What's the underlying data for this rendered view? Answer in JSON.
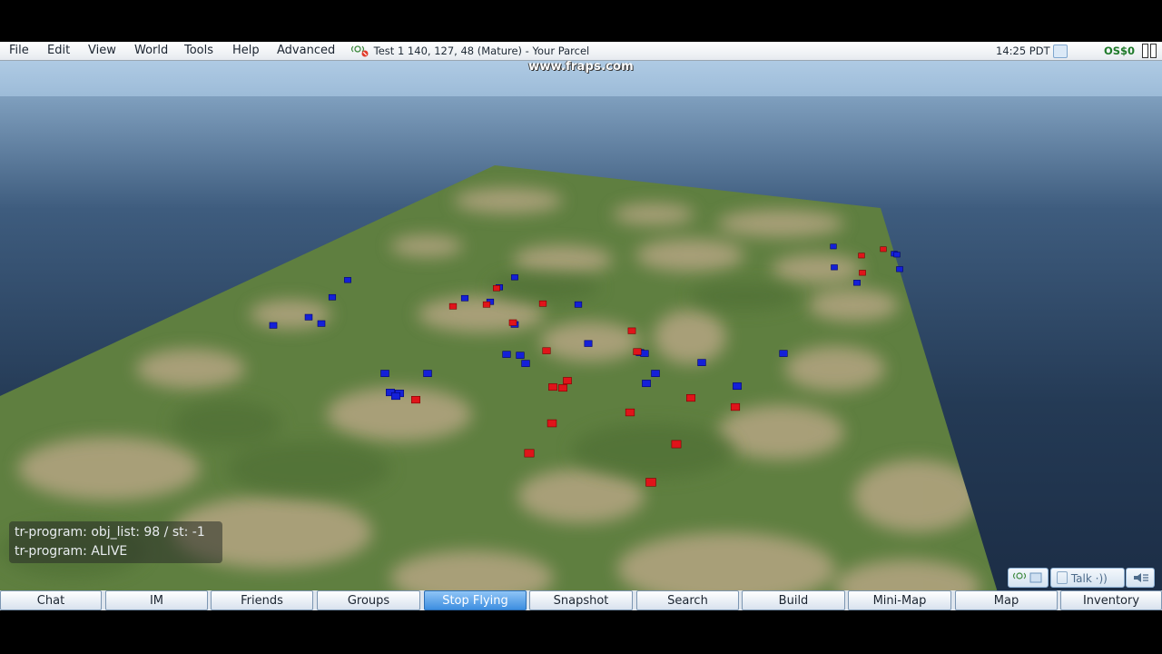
{
  "menu": {
    "items": [
      "File",
      "Edit",
      "View",
      "World",
      "Tools",
      "Help",
      "Advanced"
    ]
  },
  "status": {
    "location": "Test 1 140, 127, 48 (Mature) - Your Parcel",
    "time": "14:25 PDT",
    "balance": "OS$0"
  },
  "watermark": "www.fraps.com",
  "debug": {
    "line1": "tr-program: obj_list: 98 / st: -1",
    "line2": "tr-program: ALIVE"
  },
  "voice": {
    "talk_label": "Talk"
  },
  "toolbar": {
    "buttons": [
      "Chat",
      "IM",
      "Friends",
      "Groups",
      "Stop Flying",
      "Snapshot",
      "Search",
      "Build",
      "Mini-Map",
      "Map",
      "Inventory"
    ],
    "active": "Stop Flying"
  },
  "colors": {
    "red_object": "#e0141a",
    "blue_object": "#1420d8",
    "terrain_green": "#5d7d3e",
    "terrain_sand": "#b3a27e",
    "water": "#22354e",
    "sky": "#a9c6e2"
  }
}
